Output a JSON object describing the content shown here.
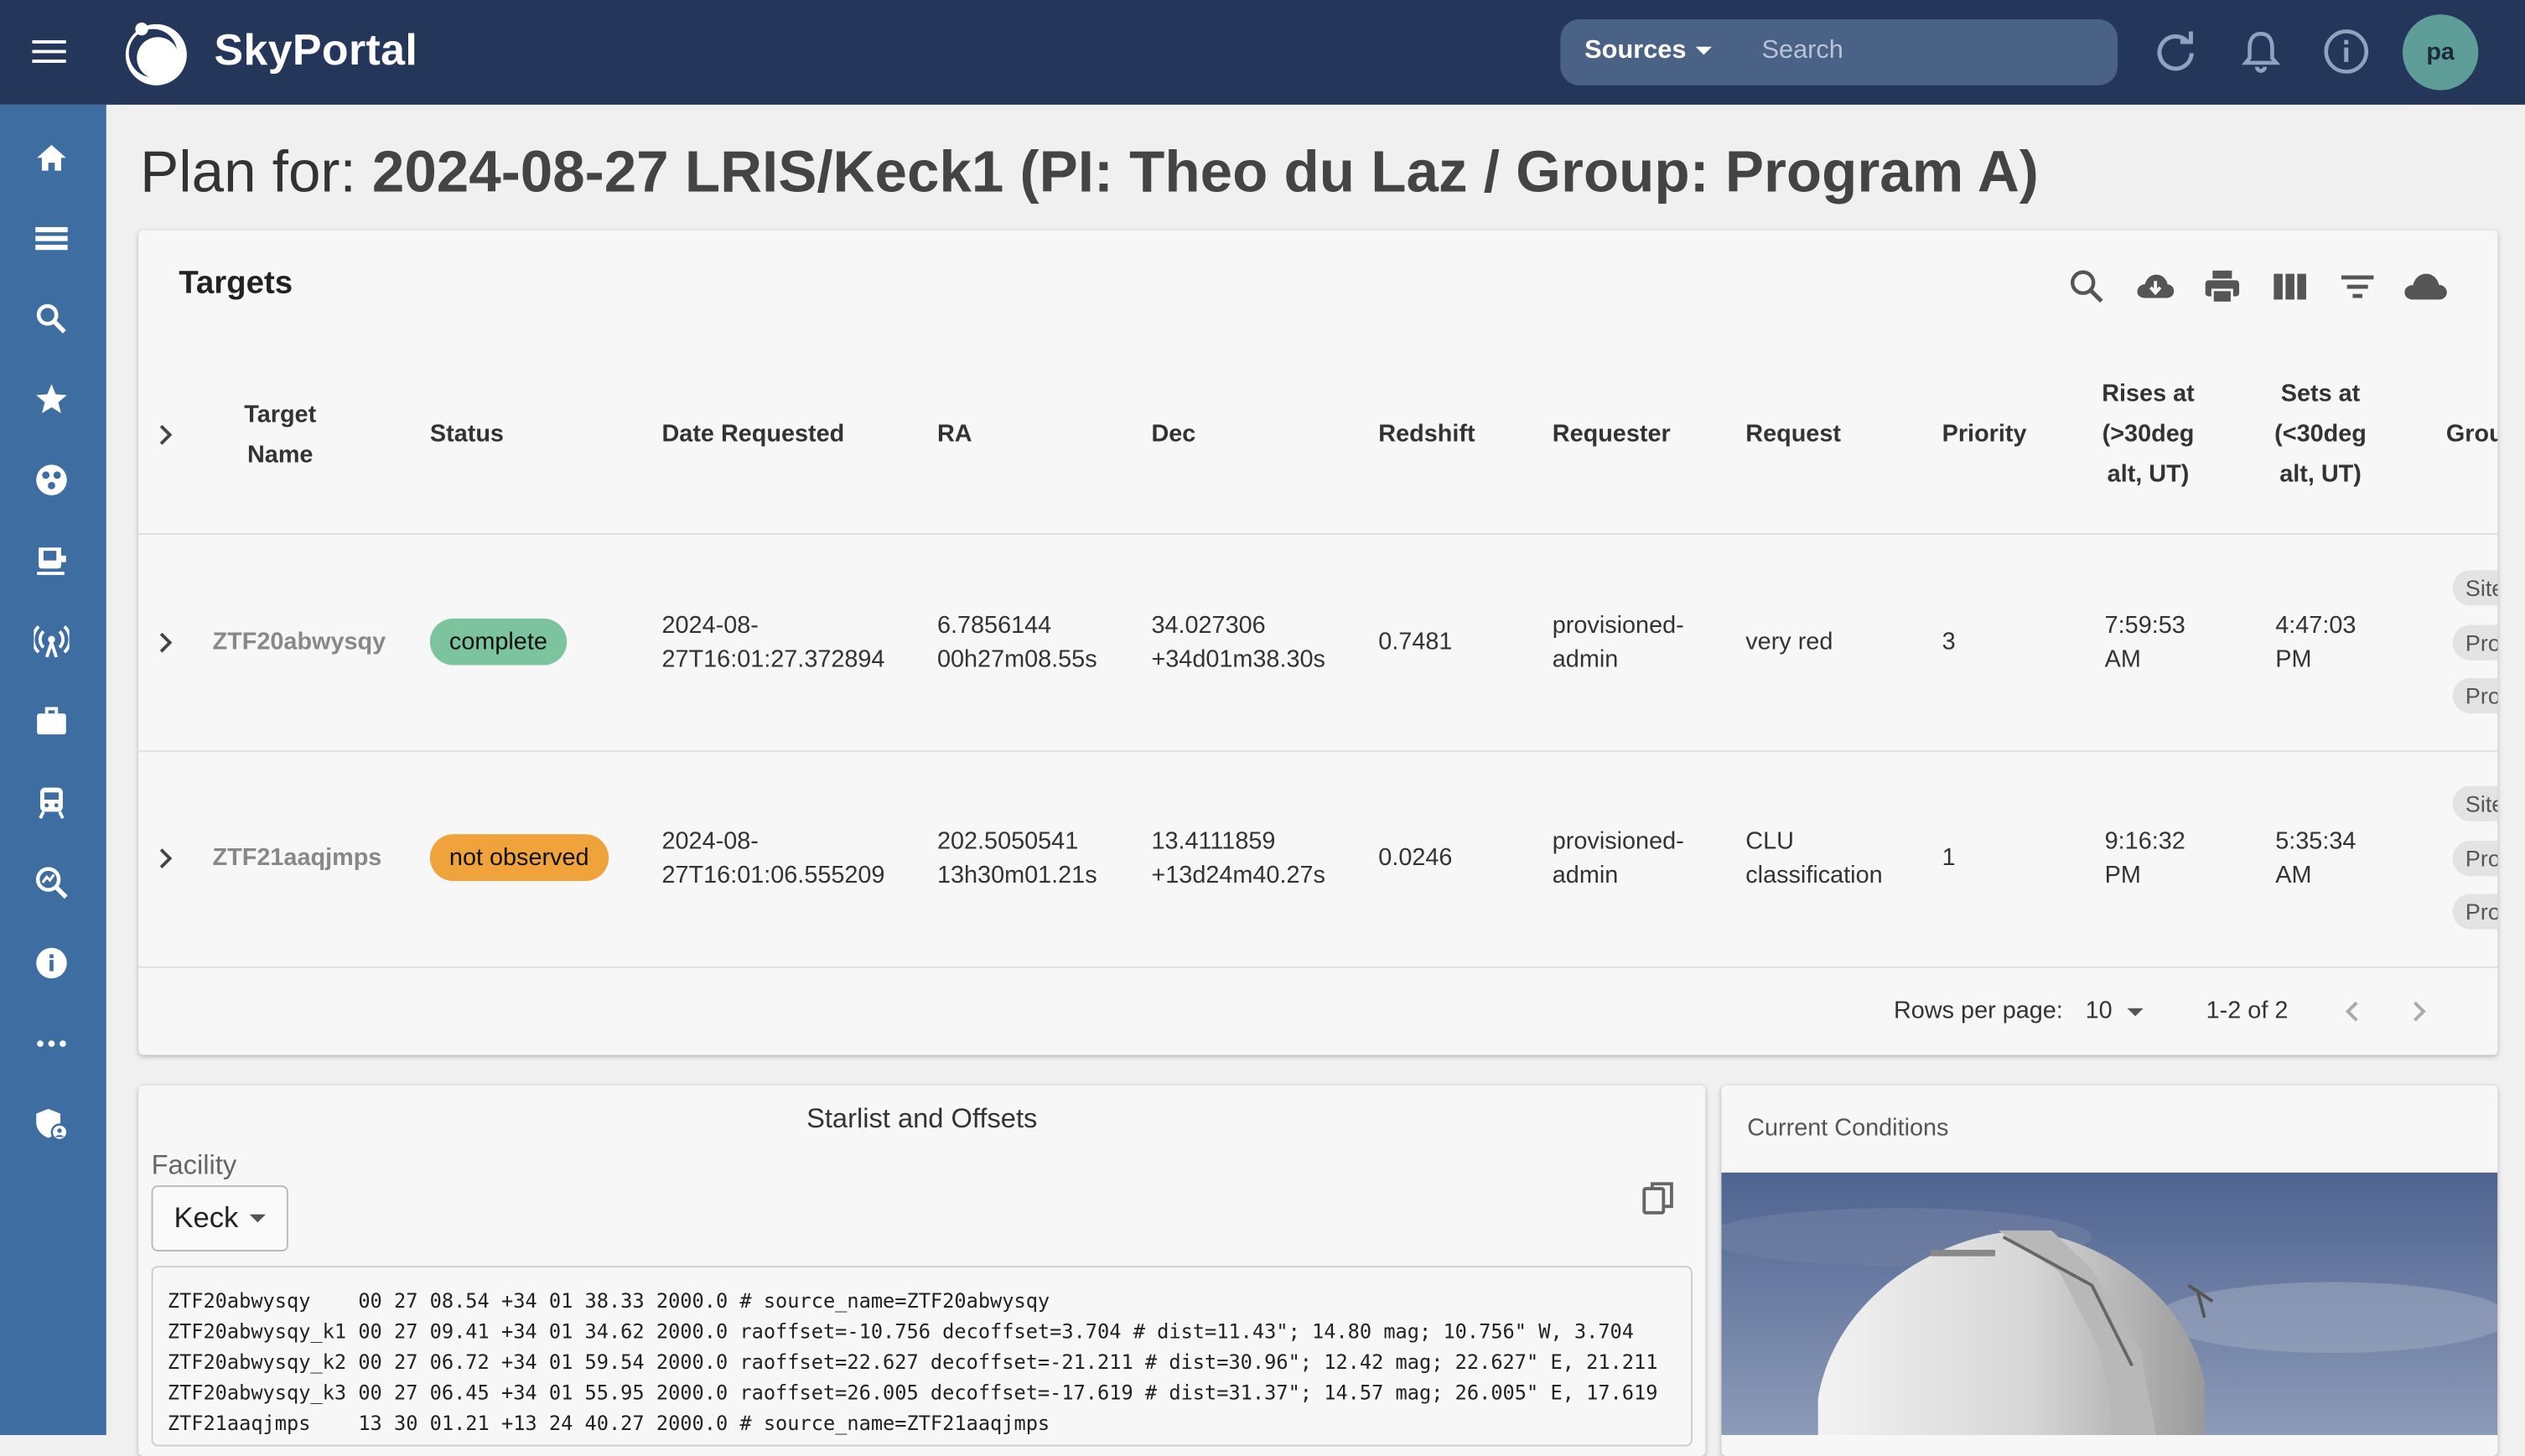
{
  "app": {
    "brand": "SkyPortal",
    "user_initials": "pa"
  },
  "search": {
    "category": "Sources",
    "placeholder": "Search"
  },
  "page": {
    "title_prefix": "Plan for: ",
    "title_main": "2024-08-27 LRIS/Keck1 (PI: Theo du Laz / Group: Program A)"
  },
  "targets": {
    "title": "Targets",
    "columns": [
      "Target Name",
      "Status",
      "Date Requested",
      "RA",
      "Dec",
      "Redshift",
      "Requester",
      "Request",
      "Priority",
      "Rises at (>30deg alt, UT)",
      "Sets at (<30deg alt, UT)",
      "Grou"
    ],
    "rows": [
      {
        "name": "ZTF20abwysqy",
        "status": "complete",
        "status_color": "#7cc49e",
        "date_1": "2024-08-",
        "date_2": "27T16:01:27.372894",
        "ra_1": "6.7856144",
        "ra_2": "00h27m08.55s",
        "dec_1": "34.027306",
        "dec_2": "+34d01m38.30s",
        "redshift": "0.7481",
        "requester_1": "provisioned-",
        "requester_2": "admin",
        "request_1": "very red",
        "request_2": "",
        "priority": "3",
        "rises_1": "7:59:53",
        "rises_2": "AM",
        "sets_1": "4:47:03",
        "sets_2": "PM",
        "groups": [
          "Site",
          "Pro",
          "Pro"
        ]
      },
      {
        "name": "ZTF21aaqjmps",
        "status": "not observed",
        "status_color": "#f0a33a",
        "date_1": "2024-08-",
        "date_2": "27T16:01:06.555209",
        "ra_1": "202.5050541",
        "ra_2": "13h30m01.21s",
        "dec_1": "13.4111859",
        "dec_2": "+13d24m40.27s",
        "redshift": "0.0246",
        "requester_1": "provisioned-",
        "requester_2": "admin",
        "request_1": "CLU",
        "request_2": "classification",
        "priority": "1",
        "rises_1": "9:16:32",
        "rises_2": "PM",
        "sets_1": "5:35:34",
        "sets_2": "AM",
        "groups": [
          "Site",
          "Pro",
          "Pro"
        ]
      }
    ],
    "pagination": {
      "rows_per_page_label": "Rows per page:",
      "rows_per_page": "10",
      "range": "1-2 of 2"
    }
  },
  "starlist": {
    "title": "Starlist and Offsets",
    "facility_label": "Facility",
    "facility": "Keck",
    "lines": [
      "ZTF20abwysqy    00 27 08.54 +34 01 38.33 2000.0 # source_name=ZTF20abwysqy",
      "ZTF20abwysqy_k1 00 27 09.41 +34 01 34.62 2000.0 raoffset=-10.756 decoffset=3.704 # dist=11.43\"; 14.80 mag; 10.756\" W, 3.704",
      "ZTF20abwysqy_k2 00 27 06.72 +34 01 59.54 2000.0 raoffset=22.627 decoffset=-21.211 # dist=30.96\"; 12.42 mag; 22.627\" E, 21.211",
      "ZTF20abwysqy_k3 00 27 06.45 +34 01 55.95 2000.0 raoffset=26.005 decoffset=-17.619 # dist=31.37\"; 14.57 mag; 26.005\" E, 17.619",
      "ZTF21aaqjmps    13 30 01.21 +13 24 40.27 2000.0 # source_name=ZTF21aaqjmps"
    ]
  },
  "conditions": {
    "title": "Current Conditions"
  }
}
